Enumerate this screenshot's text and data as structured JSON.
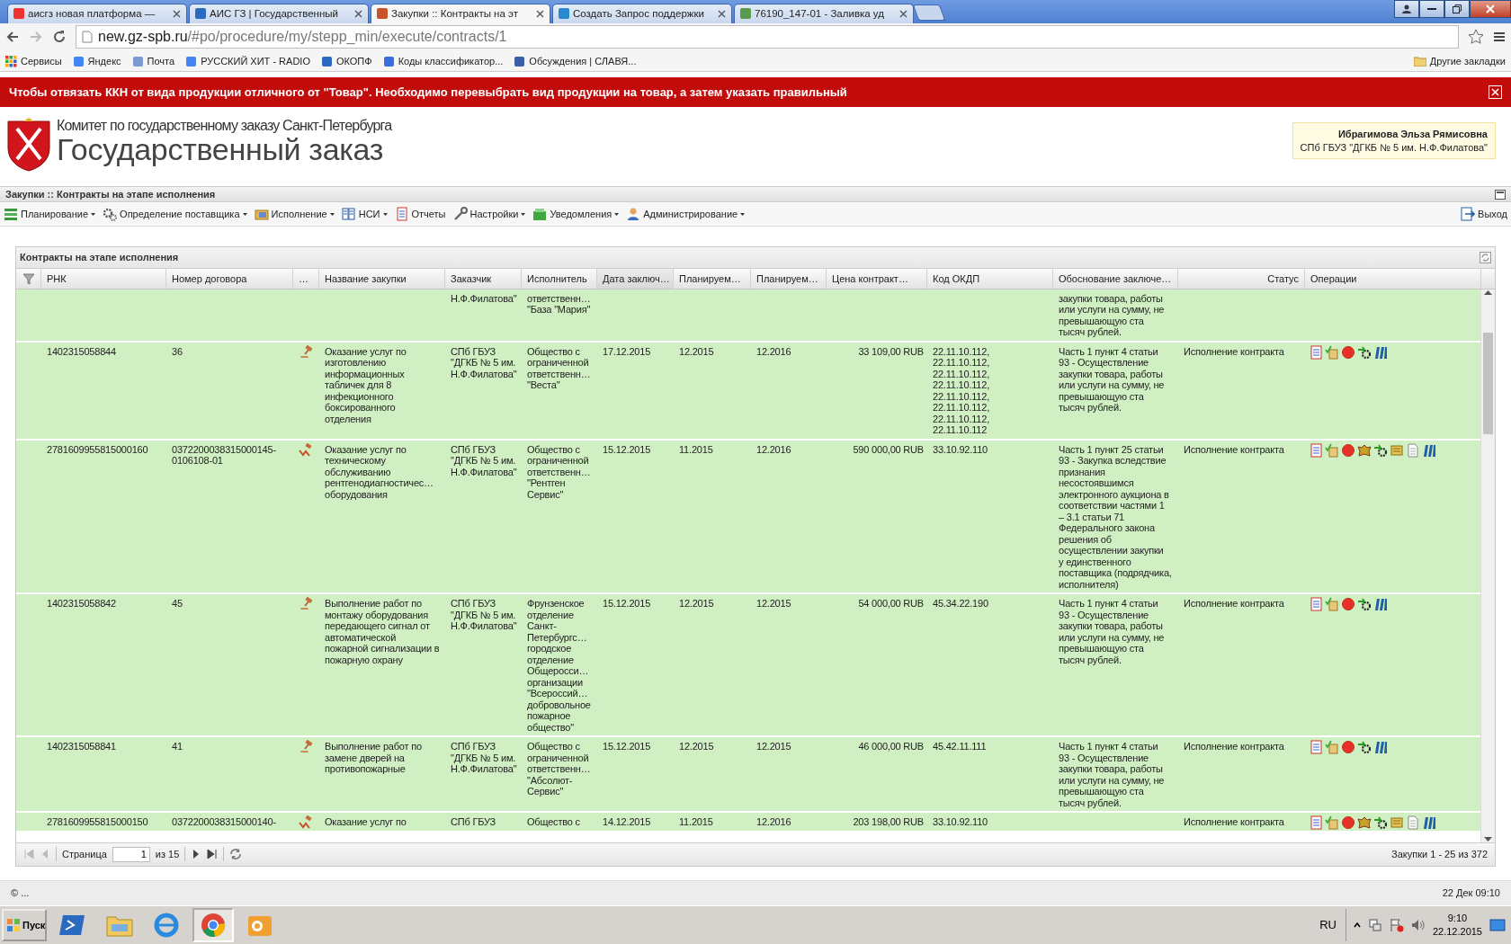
{
  "browser": {
    "tabs": [
      {
        "title": "аисгз новая платформа —",
        "selected": false
      },
      {
        "title": "АИС ГЗ | Государственный",
        "selected": false
      },
      {
        "title": "Закупки :: Контракты на эт",
        "selected": true
      },
      {
        "title": "Создать Запрос поддержки",
        "selected": false
      },
      {
        "title": "76190_147-01 - Заливка уд",
        "selected": false
      }
    ],
    "address": {
      "host": "new.gz-spb.ru",
      "path": "/#po/procedure/my/stepp_min/execute/contracts/1"
    },
    "bookmarks": [
      "Сервисы",
      "Яндекс",
      "Почта",
      "РУССКИЙ ХИТ - RADIO",
      "ОКОПФ",
      "Коды классификатор...",
      "Обсуждения | СЛАВЯ..."
    ],
    "other_bookmarks": "Другие закладки"
  },
  "banner": {
    "text": "Чтобы отвязать ККН от вида продукции отличного от \"Товар\". Необходимо перевыбрать вид продукции на товар, а затем указать правильный"
  },
  "header": {
    "subtitle": "Комитет по государственному заказу Санкт-Петербурга",
    "title": "Государственный заказ",
    "user": {
      "name": "Ибрагимова Эльза Рямисовна",
      "org": "СПб ГБУЗ \"ДГКБ № 5 им. Н.Ф.Филатова\""
    }
  },
  "panel_title": "Закупки :: Контракты на этапе исполнения",
  "menu": [
    {
      "label": "Планирование",
      "has_menu": true
    },
    {
      "label": "Определение поставщика",
      "has_menu": true
    },
    {
      "label": "Исполнение",
      "has_menu": true
    },
    {
      "label": "НСИ",
      "has_menu": true
    },
    {
      "label": "Отчеты",
      "has_menu": false
    },
    {
      "label": "Настройки",
      "has_menu": true
    },
    {
      "label": "Уведомления",
      "has_menu": true
    },
    {
      "label": "Администрирование",
      "has_menu": true
    }
  ],
  "logout": "Выход",
  "grid": {
    "title": "Контракты на этапе исполнения",
    "columns": [
      {
        "label": "РНК",
        "sorted": false
      },
      {
        "label": "Номер договора",
        "sorted": false
      },
      {
        "label": "…",
        "sorted": false
      },
      {
        "label": "Название закупки",
        "sorted": false
      },
      {
        "label": "Заказчик",
        "sorted": false
      },
      {
        "label": "Исполнитель",
        "sorted": false
      },
      {
        "label": "Дата заключ…",
        "sorted": true
      },
      {
        "label": "Планируем…",
        "sorted": false
      },
      {
        "label": "Планируем…",
        "sorted": false
      },
      {
        "label": "Цена контракт…",
        "sorted": false
      },
      {
        "label": "Код ОКДП",
        "sorted": false
      },
      {
        "label": "Обоснование заключе…",
        "sorted": false
      },
      {
        "label": "Статус",
        "sorted": false
      },
      {
        "label": "Операции",
        "sorted": false
      }
    ],
    "rows": [
      {
        "customer": "Н.Ф.Филатова\"",
        "supplier": "ответственн…\n\"База \"Мария\"",
        "reason": "закупки товара, работы\nили услуги на сумму, не\nпревышающую ста\nтысяч рублей."
      },
      {
        "rnk": "1402315058844",
        "number": "36",
        "kind": "single",
        "name": "Оказание услуг по\nизготовлению\nинформационных\nтабличек для 8\nинфекционного\nбоксированного\nотделения",
        "customer": "СПб ГБУЗ\n\"ДГКБ № 5 им.\nН.Ф.Филатова\"",
        "supplier": "Общество с\nограниченной\nответственн…\n\"Веста\"",
        "date": "17.12.2015",
        "plan_start": "12.2015",
        "plan_end": "12.2016",
        "price": "33 109,00 RUB",
        "okdp": "22.11.10.112,\n22.11.10.112,\n22.11.10.112,\n22.11.10.112,\n22.11.10.112,\n22.11.10.112,\n22.11.10.112,\n22.11.10.112",
        "reason": "Часть 1 пункт 4 статьи\n93 - Осуществление\nзакупки товара, работы\nили услуги на сумму, не\nпревышающую ста\nтысяч рублей.",
        "status": "Исполнение контракта"
      },
      {
        "rnk": "2781609955815000160",
        "number": "0372200038315000145-\n0106108-01",
        "kind": "auction",
        "name": "Оказание услуг по\nтехническому\nобслуживанию\nрентгенодиагностичес…\nоборудования",
        "customer": "СПб ГБУЗ\n\"ДГКБ № 5 им.\nН.Ф.Филатова\"",
        "supplier": "Общество с\nограниченной\nответственн…\n\"Рентген\nСервис\"",
        "date": "15.12.2015",
        "plan_start": "11.2015",
        "plan_end": "12.2016",
        "price": "590 000,00 RUB",
        "okdp": "33.10.92.110",
        "reason": "Часть 1 пункт 25 статьи\n93 - Закупка вследствие\nпризнания\nнесостоявшимся\nэлектронного аукциона в\nсоответствии частями 1\n– 3.1 статьи 71\nФедерального закона\nрешения об\nосуществлении закупки\nу единственного\nпоставщика (подрядчика,\nисполнителя)",
        "status": "Исполнение контракта"
      },
      {
        "rnk": "1402315058842",
        "number": "45",
        "kind": "single",
        "name": "Выполнение работ по\nмонтажу оборудования\nпередающего сигнал от\nавтоматической\nпожарной сигнализации в\nпожарную охрану",
        "customer": "СПб ГБУЗ\n\"ДГКБ № 5 им.\nН.Ф.Филатова\"",
        "supplier": "Фрунзенское\nотделение\nСанкт-\nПетербургс…\nгородское\nотделение\nОбщеросси…\nорганизации\n\"Всероссий…\nдобровольное\nпожарное\nобщество\"",
        "date": "15.12.2015",
        "plan_start": "12.2015",
        "plan_end": "12.2015",
        "price": "54 000,00 RUB",
        "okdp": "45.34.22.190",
        "reason": "Часть 1 пункт 4 статьи\n93 - Осуществление\nзакупки товара, работы\nили услуги на сумму, не\nпревышающую ста\nтысяч рублей.",
        "status": "Исполнение контракта"
      },
      {
        "rnk": "1402315058841",
        "number": "41",
        "kind": "single",
        "name": "Выполнение работ по\nзамене дверей на\nпротивопожарные",
        "customer": "СПб ГБУЗ\n\"ДГКБ № 5 им.\nН.Ф.Филатова\"",
        "supplier": "Общество с\nограниченной\nответственн…\n\"Абсолют-\nСервис\"",
        "date": "15.12.2015",
        "plan_start": "12.2015",
        "plan_end": "12.2015",
        "price": "46 000,00 RUB",
        "okdp": "45.42.11.111",
        "reason": "Часть 1 пункт 4 статьи\n93 - Осуществление\nзакупки товара, работы\nили услуги на сумму, не\nпревышающую ста\nтысяч рублей.",
        "status": "Исполнение контракта"
      },
      {
        "rnk": "2781609955815000150",
        "number": "0372200038315000140-",
        "kind": "auction",
        "name": "Оказание услуг по",
        "customer": "СПб ГБУЗ",
        "supplier": "Общество с",
        "date": "14.12.2015",
        "plan_start": "11.2015",
        "plan_end": "12.2016",
        "price": "203 198,00 RUB",
        "okdp": "33.10.92.110",
        "status": "Исполнение контракта"
      }
    ],
    "pager": {
      "label": "Страница",
      "page": "1",
      "of": "из 15",
      "at_start": true,
      "summary": "Закупки 1 - 25 из 372"
    }
  },
  "footer": {
    "copyright": "© ...",
    "datetime": "22 Дек 09:10"
  },
  "taskbar": {
    "start": "Пуск",
    "apps": [
      {
        "selected": false
      },
      {
        "selected": false
      },
      {
        "selected": false
      },
      {
        "selected": true
      },
      {
        "selected": false
      }
    ],
    "lang": "RU",
    "time": "9:10",
    "date": "22.12.2015"
  }
}
